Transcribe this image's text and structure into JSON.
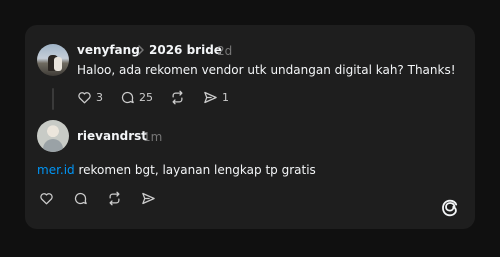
{
  "post": {
    "username": "venyfang",
    "tag": "2026 bride",
    "time": "2d",
    "text": "Haloo, ada rekomen vendor utk undangan digital kah? Thanks!",
    "likes": "3",
    "comments": "25",
    "shares": "1"
  },
  "reply": {
    "username": "rievandrst",
    "time": "1m",
    "mention": "mer.id",
    "text": " rekomen bgt, layanan lengkap tp gratis"
  },
  "icons": {
    "chevron": "chevron-right-icon",
    "like": "heart-icon",
    "comment": "comment-icon",
    "repost": "repost-icon",
    "share": "send-icon",
    "brand": "threads-logo-icon"
  }
}
